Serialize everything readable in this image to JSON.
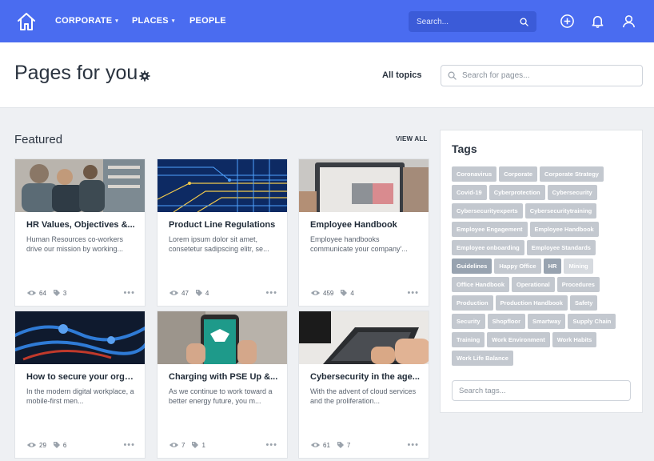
{
  "nav": {
    "items": [
      {
        "label": "CORPORATE",
        "has_caret": true
      },
      {
        "label": "PLACES",
        "has_caret": true
      },
      {
        "label": "PEOPLE",
        "has_caret": false
      }
    ],
    "search_placeholder": "Search...",
    "color": "#4a6cf0",
    "icons": [
      "home-icon",
      "search-icon",
      "add-circle-icon",
      "bell-icon",
      "user-icon"
    ]
  },
  "header": {
    "title": "Pages for you",
    "all_topics": "All topics",
    "search_placeholder": "Search for pages..."
  },
  "featured": {
    "title": "Featured",
    "view_all": "VIEW ALL",
    "cards": [
      {
        "title": "HR Values, Objectives &...",
        "desc": "Human Resources co-workers drive our mission by working...",
        "views": "64",
        "tags": "3"
      },
      {
        "title": "Product Line Regulations",
        "desc": "Lorem ipsum dolor sit amet, consetetur sadipscing elitr, se...",
        "views": "47",
        "tags": "4"
      },
      {
        "title": "Employee Handbook",
        "desc": "Employee handbooks communicate your company'...",
        "views": "459",
        "tags": "4"
      },
      {
        "title": "How to secure your orga...",
        "desc": "In the modern digital workplace, a mobile-first men...",
        "views": "29",
        "tags": "6"
      },
      {
        "title": "Charging with PSE Up &...",
        "desc": "As we continue to work toward a better energy future, you m...",
        "views": "7",
        "tags": "1"
      },
      {
        "title": "Cybersecurity in the age...",
        "desc": "With the advent of cloud services and the proliferation...",
        "views": "61",
        "tags": "7"
      }
    ]
  },
  "tags": {
    "title": "Tags",
    "items": [
      "Coronavirus",
      "Corporate",
      "Corporate Strategy",
      "Covid-19",
      "Cyberprotection",
      "Cybersecurity",
      "Cybersecurityexperts",
      "Cybersecuritytraining",
      "Employee Engagement",
      "Employee Handbook",
      "Employee onboarding",
      "Employee Standards",
      "Guidelines",
      "Happy Office",
      "HR",
      "Mining",
      "Office Handbook",
      "Operational",
      "Procedures",
      "Production",
      "Production Handbook",
      "Safety",
      "Security",
      "Shopfloor",
      "Smartway",
      "Supply Chain",
      "Training",
      "Work Environment",
      "Work Habits",
      "Work Life Balance"
    ],
    "search_placeholder": "Search tags..."
  }
}
